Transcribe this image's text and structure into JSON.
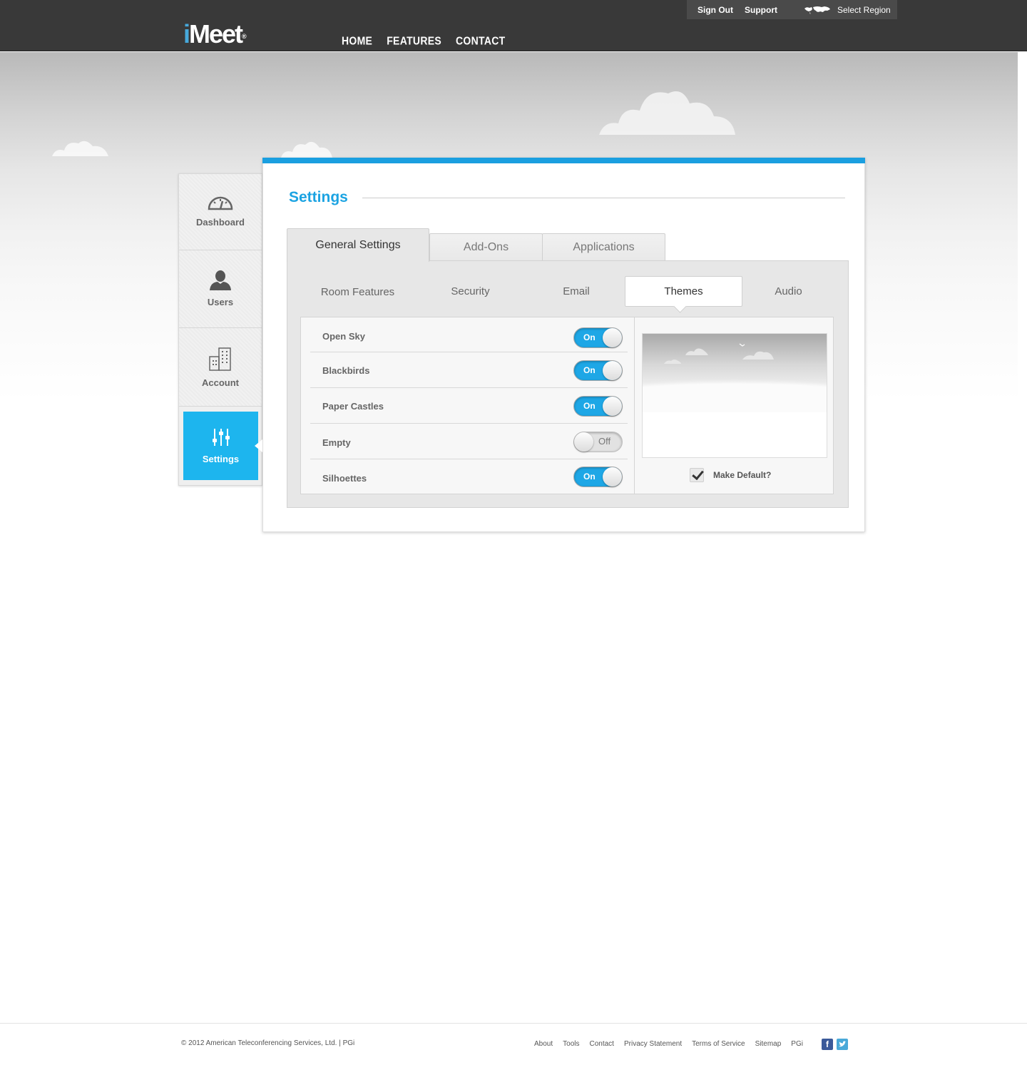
{
  "header": {
    "util": {
      "sign_out": "Sign Out",
      "support": "Support",
      "select_region": "Select Region"
    },
    "logo": {
      "i": "i",
      "rest": "Meet",
      "reg": "®"
    },
    "nav": [
      "HOME",
      "FEATURES",
      "CONTACT"
    ]
  },
  "sidebar": {
    "items": [
      {
        "label": "Dashboard",
        "icon": "speedometer-icon"
      },
      {
        "label": "Users",
        "icon": "user-icon"
      },
      {
        "label": "Account",
        "icon": "building-icon"
      },
      {
        "label": "Settings",
        "icon": "sliders-icon",
        "active": true
      }
    ]
  },
  "main": {
    "title": "Settings",
    "tabs": [
      "General Settings",
      "Add-Ons",
      "Applications"
    ],
    "active_tab": "General Settings",
    "subtabs": [
      "Room Features",
      "Security",
      "Email",
      "Themes",
      "Audio"
    ],
    "active_subtab": "Themes",
    "themes": [
      {
        "name": "Open Sky",
        "state": "On"
      },
      {
        "name": "Blackbirds",
        "state": "On"
      },
      {
        "name": "Paper Castles",
        "state": "On"
      },
      {
        "name": "Empty",
        "state": "Off"
      },
      {
        "name": "Silhoettes",
        "state": "On"
      }
    ],
    "make_default_label": "Make Default?",
    "make_default_checked": true
  },
  "footer": {
    "copyright": "© 2012 American Teleconferencing Services, Ltd. | PGi",
    "links": [
      "About",
      "Tools",
      "Contact",
      "Privacy Statement",
      "Terms of Service",
      "Sitemap",
      "PGi"
    ],
    "social": [
      "facebook-icon",
      "twitter-icon"
    ]
  },
  "colors": {
    "accent": "#1ba3e2",
    "header_bg": "#393939",
    "active_sidebar": "#1db5ee"
  }
}
